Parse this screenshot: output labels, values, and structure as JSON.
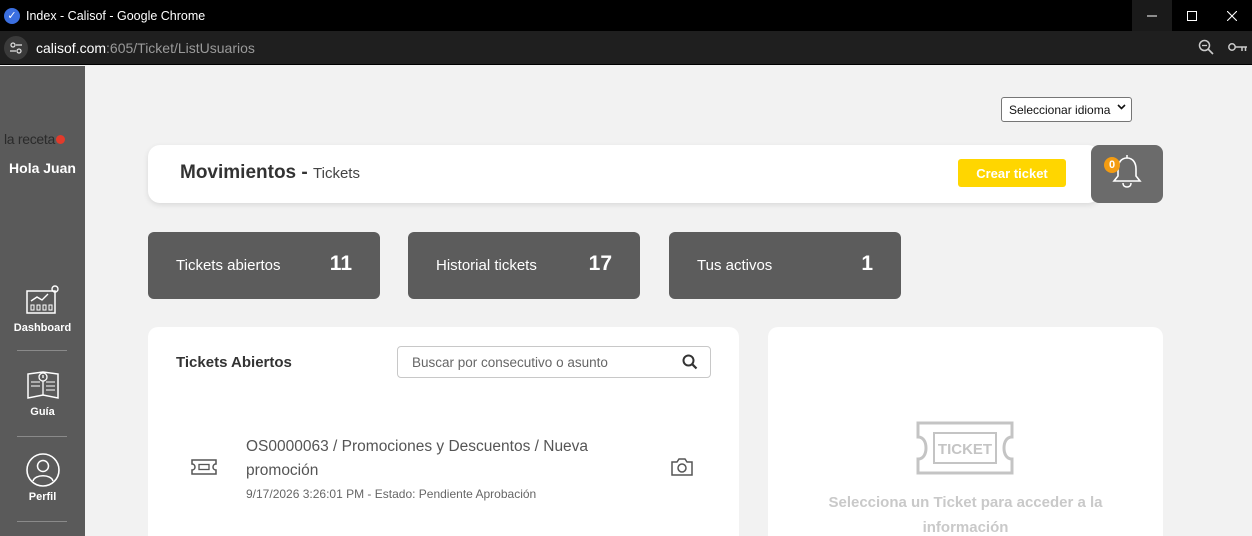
{
  "browser": {
    "window_title": "Index - Calisof - Google Chrome",
    "url_host": "calisof.com",
    "url_rest": ":605/Ticket/ListUsuarios"
  },
  "sidebar": {
    "brand": "la receta",
    "greeting": "Hola Juan",
    "items": [
      {
        "label": "Dashboard",
        "icon": "dashboard-icon"
      },
      {
        "label": "Guía",
        "icon": "book-icon"
      },
      {
        "label": "Perfil",
        "icon": "user-icon"
      }
    ]
  },
  "main": {
    "language_select": "Seleccionar idioma",
    "header": {
      "title": "Movimientos",
      "separator": "-",
      "subtitle": "Tickets",
      "create_button": "Crear ticket",
      "notifications_count": "0"
    },
    "stats": [
      {
        "label": "Tickets abiertos",
        "value": "11"
      },
      {
        "label": "Historial tickets",
        "value": "17"
      },
      {
        "label": "Tus activos",
        "value": "1"
      }
    ],
    "list": {
      "title": "Tickets Abiertos",
      "search_placeholder": "Buscar por consecutivo o asunto",
      "items": [
        {
          "title": "OS0000063 / Promociones y Descuentos / Nueva promoción",
          "meta": "9/17/2026 3:26:01 PM - Estado: Pendiente Aprobación"
        }
      ]
    },
    "detail": {
      "ticket_label": "TICKET",
      "empty_text": "Selecciona un Ticket para acceder a la información"
    }
  },
  "colors": {
    "sidebar": "#5a5a5a",
    "accent": "#ffd600",
    "badge": "#f39c12",
    "stat_card": "#5c5c5c"
  }
}
